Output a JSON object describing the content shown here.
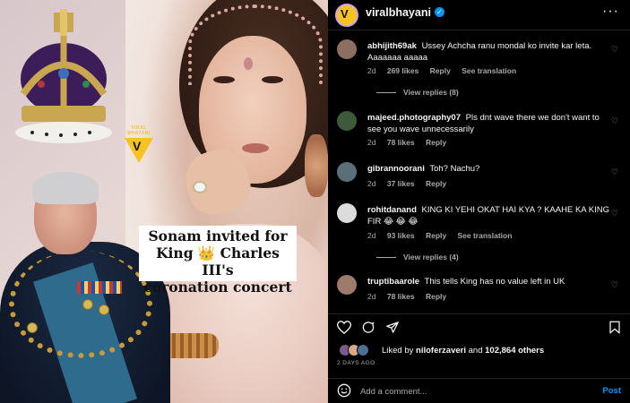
{
  "post": {
    "brand_small": "VIRAL BHAYANI",
    "brand_letter": "V",
    "caption_line1": "Sonam invited for",
    "caption_line2": "King 👑 Charles III's",
    "caption_line3": "coronation concert"
  },
  "header": {
    "username": "viralbhayani",
    "verified_icon": "verified-badge-icon",
    "more_icon": "more-horizontal-icon"
  },
  "comments": [
    {
      "user": "abhijith69ak",
      "text": "Ussey Achcha ranu mondal ko invite kar leta. Aaaaaaa aaaaa",
      "time": "2d",
      "likes": "269 likes",
      "reply": "Reply",
      "translate": "See translation",
      "replies": "View replies (8)",
      "avatar_color": "#8d6e63"
    },
    {
      "user": "majeed.photography07",
      "text": "Pls dnt wave there we don't want to see you wave unnecessarily",
      "time": "2d",
      "likes": "78 likes",
      "reply": "Reply",
      "avatar_color": "#3d5a3a"
    },
    {
      "user": "gibrannoorani",
      "text": "Toh? Nachu?",
      "time": "2d",
      "likes": "37 likes",
      "reply": "Reply",
      "avatar_color": "#5a6f7a"
    },
    {
      "user": "rohitdanand",
      "text": "KING KI YEHI OKAT HAI KYA ? KAAHE KA KING FIR 😂 😂 😂",
      "time": "2d",
      "likes": "93 likes",
      "reply": "Reply",
      "translate": "See translation",
      "replies": "View replies (4)",
      "avatar_color": "#dcdcdc"
    },
    {
      "user": "truptibaarole",
      "text": "This tells King has no value left in UK",
      "time": "2d",
      "likes": "78 likes",
      "reply": "Reply",
      "avatar_color": "#9c7b6a"
    }
  ],
  "actions": {
    "like_icon": "heart-icon",
    "comment_icon": "comment-icon",
    "share_icon": "share-icon",
    "save_icon": "bookmark-icon"
  },
  "likes": {
    "liked_by_prefix": "Liked by ",
    "liked_by_user": "niloferzaveri",
    "and": " and ",
    "others": "102,864 others"
  },
  "timestamp": "2 DAYS AGO",
  "add_comment": {
    "placeholder": "Add a comment...",
    "post_label": "Post"
  },
  "colors": {
    "accent": "#0095f6",
    "brand": "#f6c31f",
    "background": "#000000",
    "muted_text": "#a8a8a8"
  }
}
